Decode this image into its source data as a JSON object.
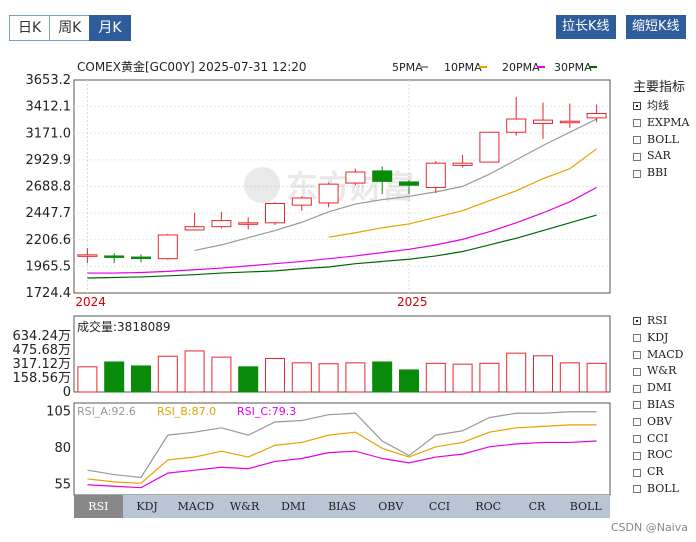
{
  "tabs": [
    {
      "label": "日K",
      "active": false
    },
    {
      "label": "周K",
      "active": false
    },
    {
      "label": "月K",
      "active": true
    }
  ],
  "buttons": {
    "stretch": "拉长K线",
    "shorten": "缩短K线"
  },
  "header": {
    "info": "COMEX黄金[GC00Y] 2025-07-31 12:20",
    "ma_legend": [
      {
        "label": "5PMA",
        "color": "#999999"
      },
      {
        "label": "10PMA",
        "color": "#e8a000"
      },
      {
        "label": "20PMA",
        "color": "#e600e6"
      },
      {
        "label": "30PMA",
        "color": "#006600"
      }
    ]
  },
  "indicators": {
    "title": "主要指标",
    "items": [
      "均线",
      "EXPMA",
      "BOLL",
      "SAR",
      "BBI"
    ],
    "selected": "均线"
  },
  "sub_indicators": {
    "items": [
      "RSI",
      "KDJ",
      "MACD",
      "W&R",
      "DMI",
      "BIAS",
      "OBV",
      "CCI",
      "ROC",
      "CR",
      "BOLL"
    ],
    "selected": "RSI"
  },
  "volume": {
    "label": "成交量:3818089",
    "ticks": [
      "634.24万",
      "475.68万",
      "317.12万",
      "158.56万",
      "0"
    ]
  },
  "rsi": {
    "legend": [
      "RSI_A:92.6",
      "RSI_B:87.0",
      "RSI_C:79.3"
    ],
    "ticks": [
      "105",
      "80",
      "55"
    ]
  },
  "bottom_tabs": {
    "items": [
      "RSI",
      "KDJ",
      "MACD",
      "W&R",
      "DMI",
      "BIAS",
      "OBV",
      "CCI",
      "ROC",
      "CR",
      "BOLL"
    ],
    "active": "RSI"
  },
  "watermark": "CSDN @Naiva",
  "chart_data": {
    "type": "candlestick",
    "price_ticks": [
      3653.2,
      3412.1,
      3171.0,
      2929.9,
      2688.8,
      2447.7,
      2206.6,
      1965.5,
      1724.4
    ],
    "ylim": [
      1724.4,
      3653.2
    ],
    "x_labels": [
      "2024",
      "2025"
    ],
    "candles": [
      {
        "o": 2070,
        "c": 2070,
        "h": 2130,
        "l": 1995
      },
      {
        "o": 2060,
        "c": 2050,
        "h": 2085,
        "l": 1995
      },
      {
        "o": 2050,
        "c": 2045,
        "h": 2075,
        "l": 2000
      },
      {
        "o": 2035,
        "c": 2250,
        "h": 2260,
        "l": 2025
      },
      {
        "o": 2295,
        "c": 2325,
        "h": 2450,
        "l": 2290
      },
      {
        "o": 2325,
        "c": 2380,
        "h": 2460,
        "l": 2310
      },
      {
        "o": 2355,
        "c": 2360,
        "h": 2410,
        "l": 2300
      },
      {
        "o": 2360,
        "c": 2535,
        "h": 2545,
        "l": 2340
      },
      {
        "o": 2520,
        "c": 2585,
        "h": 2600,
        "l": 2470
      },
      {
        "o": 2540,
        "c": 2710,
        "h": 2725,
        "l": 2500
      },
      {
        "o": 2720,
        "c": 2820,
        "h": 2850,
        "l": 2700
      },
      {
        "o": 2830,
        "c": 2735,
        "h": 2870,
        "l": 2620
      },
      {
        "o": 2730,
        "c": 2700,
        "h": 2750,
        "l": 2620
      },
      {
        "o": 2680,
        "c": 2900,
        "h": 2920,
        "l": 2630
      },
      {
        "o": 2880,
        "c": 2900,
        "h": 2975,
        "l": 2860
      },
      {
        "o": 2910,
        "c": 3180,
        "h": 3185,
        "l": 2905
      },
      {
        "o": 3180,
        "c": 3300,
        "h": 3500,
        "l": 3150
      },
      {
        "o": 3260,
        "c": 3290,
        "h": 3450,
        "l": 3120
      },
      {
        "o": 3280,
        "c": 3280,
        "h": 3440,
        "l": 3220
      },
      {
        "o": 3310,
        "c": 3350,
        "h": 3430,
        "l": 3270
      }
    ],
    "ma": {
      "5PMA": [
        null,
        null,
        null,
        null,
        2110,
        2160,
        2225,
        2290,
        2365,
        2460,
        2530,
        2570,
        2600,
        2640,
        2690,
        2800,
        2930,
        3060,
        3180,
        3300
      ],
      "10PMA": [
        null,
        null,
        null,
        null,
        null,
        null,
        null,
        null,
        null,
        2230,
        2270,
        2315,
        2350,
        2410,
        2470,
        2560,
        2650,
        2760,
        2850,
        3030
      ],
      "20PMA": [
        1905,
        1905,
        1910,
        1920,
        1935,
        1950,
        1970,
        1990,
        2010,
        2035,
        2060,
        2090,
        2120,
        2160,
        2210,
        2280,
        2360,
        2450,
        2550,
        2680
      ],
      "30PMA": [
        1860,
        1865,
        1870,
        1880,
        1890,
        1905,
        1915,
        1925,
        1945,
        1960,
        1990,
        2010,
        2030,
        2060,
        2100,
        2160,
        2220,
        2290,
        2360,
        2430
      ]
    },
    "volume": {
      "max": 6342400,
      "values": [
        2850000,
        3400000,
        2950000,
        4050000,
        4650000,
        3950000,
        2850000,
        3800000,
        3300000,
        3200000,
        3300000,
        3400000,
        2500000,
        3250000,
        3150000,
        3250000,
        4400000,
        4100000,
        3300000,
        3250000
      ],
      "up": [
        true,
        false,
        false,
        true,
        true,
        true,
        false,
        true,
        true,
        true,
        true,
        false,
        false,
        true,
        true,
        true,
        true,
        true,
        true,
        true
      ]
    },
    "rsi": {
      "ylim": [
        47,
        110
      ],
      "A": [
        64,
        61,
        59,
        88,
        90,
        93,
        88,
        97,
        98,
        102,
        103,
        84,
        74,
        88,
        91,
        100,
        103,
        103,
        104,
        104
      ],
      "B": [
        58,
        56,
        55,
        71,
        73,
        77,
        73,
        81,
        83,
        88,
        90,
        79,
        73,
        80,
        83,
        90,
        93,
        94,
        95,
        95
      ],
      "C": [
        54,
        53,
        52,
        62,
        64,
        66,
        65,
        70,
        72,
        76,
        77,
        72,
        69,
        73,
        75,
        80,
        82,
        83,
        83,
        84
      ]
    }
  }
}
